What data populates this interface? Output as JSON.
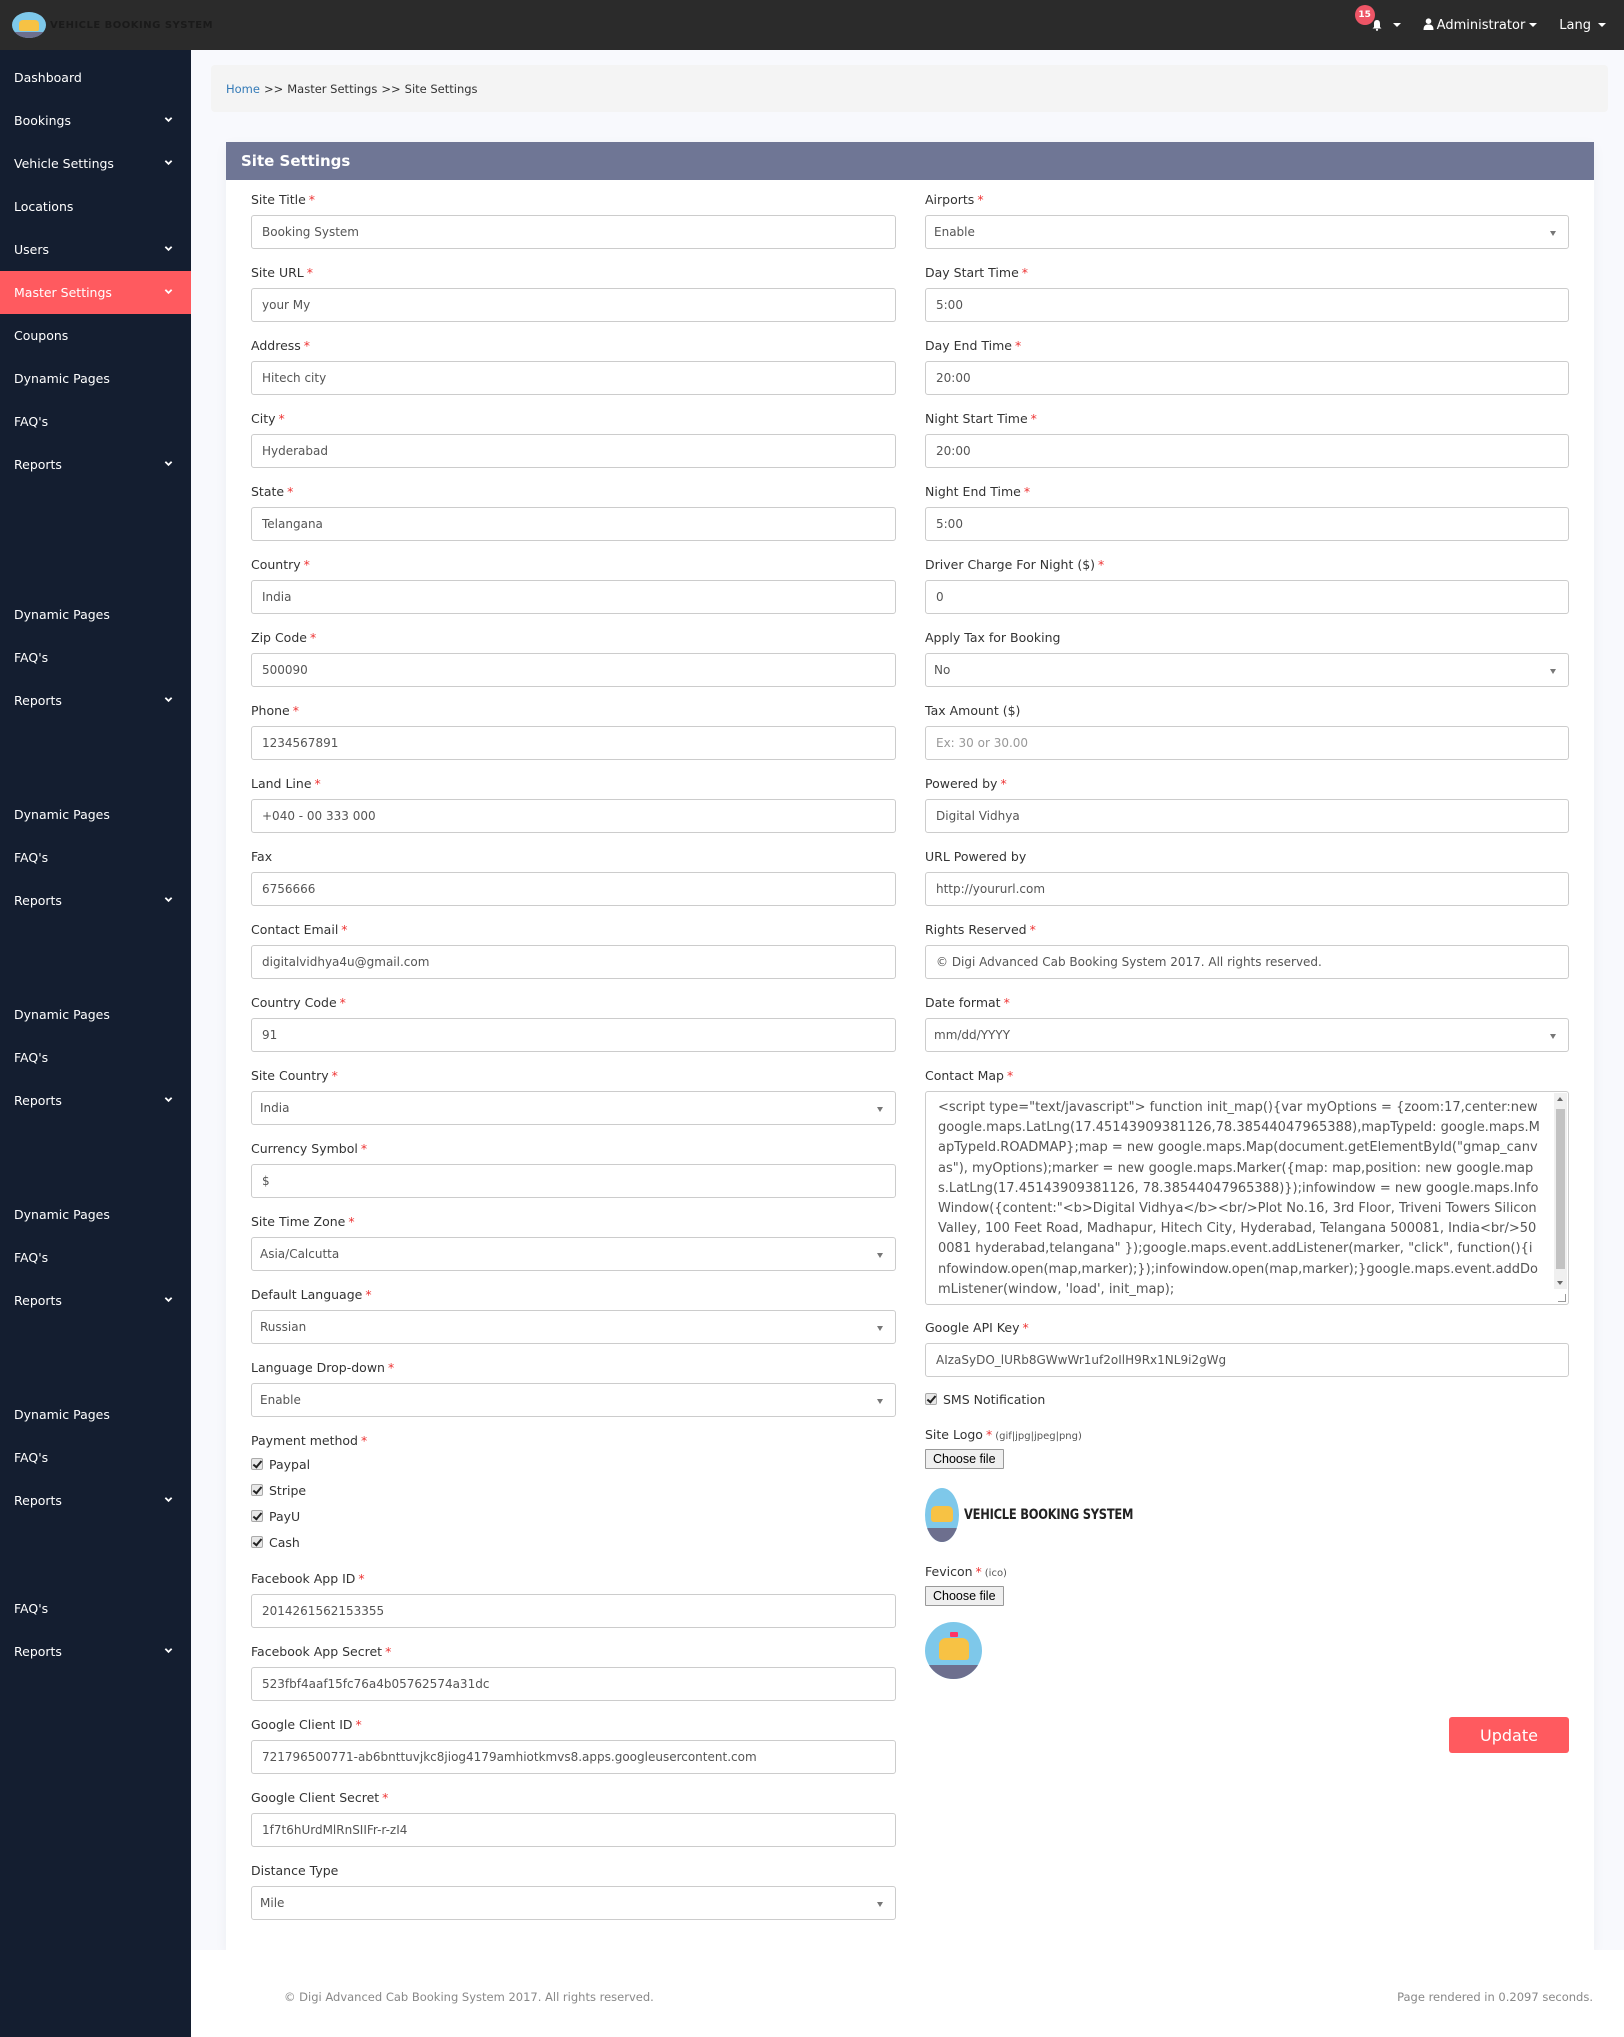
{
  "header": {
    "logo_text": "VEHICLE BOOKING SYSTEM",
    "notification_count": "15",
    "user_label": "Administrator",
    "lang_label": "Lang"
  },
  "sidebar": {
    "items": [
      {
        "label": "Dashboard",
        "has_chevron": false,
        "active": false
      },
      {
        "label": "Bookings",
        "has_chevron": true,
        "active": false
      },
      {
        "label": "Vehicle Settings",
        "has_chevron": true,
        "active": false
      },
      {
        "label": "Locations",
        "has_chevron": false,
        "active": false
      },
      {
        "label": "Users",
        "has_chevron": true,
        "active": false
      },
      {
        "label": "Master Settings",
        "has_chevron": true,
        "active": true
      },
      {
        "label": "Coupons",
        "has_chevron": false,
        "active": false
      },
      {
        "label": "Dynamic Pages",
        "has_chevron": false,
        "active": false
      },
      {
        "label": "FAQ's",
        "has_chevron": false,
        "active": false
      },
      {
        "label": "Reports",
        "has_chevron": true,
        "active": false
      },
      {
        "label": "Dynamic Pages",
        "has_chevron": false,
        "active": false
      },
      {
        "label": "FAQ's",
        "has_chevron": false,
        "active": false
      },
      {
        "label": "Reports",
        "has_chevron": true,
        "active": false
      },
      {
        "label": "Dynamic Pages",
        "has_chevron": false,
        "active": false
      },
      {
        "label": "FAQ's",
        "has_chevron": false,
        "active": false
      },
      {
        "label": "Reports",
        "has_chevron": true,
        "active": false
      },
      {
        "label": "Dynamic Pages",
        "has_chevron": false,
        "active": false
      },
      {
        "label": "FAQ's",
        "has_chevron": false,
        "active": false
      },
      {
        "label": "Reports",
        "has_chevron": true,
        "active": false
      },
      {
        "label": "Dynamic Pages",
        "has_chevron": false,
        "active": false
      },
      {
        "label": "FAQ's",
        "has_chevron": false,
        "active": false
      },
      {
        "label": "Reports",
        "has_chevron": true,
        "active": false
      },
      {
        "label": "Dynamic Pages",
        "has_chevron": false,
        "active": false
      },
      {
        "label": "FAQ's",
        "has_chevron": false,
        "active": false
      },
      {
        "label": "Reports",
        "has_chevron": true,
        "active": false
      },
      {
        "label": "FAQ's",
        "has_chevron": false,
        "active": false
      },
      {
        "label": "Reports",
        "has_chevron": true,
        "active": false
      }
    ]
  },
  "breadcrumb": {
    "home": "Home",
    "separator": ">>",
    "section": "Master Settings",
    "current": "Site Settings"
  },
  "panel": {
    "title": "Site Settings",
    "left": {
      "site_title": {
        "label": "Site Title",
        "value": "Booking System"
      },
      "site_url": {
        "label": "Site URL",
        "value": "your My"
      },
      "address": {
        "label": "Address",
        "value": "Hitech city"
      },
      "city": {
        "label": "City",
        "value": "Hyderabad"
      },
      "state": {
        "label": "State",
        "value": "Telangana"
      },
      "country": {
        "label": "Country",
        "value": "India"
      },
      "zip": {
        "label": "Zip Code",
        "value": "500090"
      },
      "phone": {
        "label": "Phone",
        "value": "1234567891"
      },
      "landline": {
        "label": "Land Line",
        "value": "+040 - 00 333 000"
      },
      "fax": {
        "label": "Fax",
        "value": "6756666"
      },
      "contact_email": {
        "label": "Contact Email",
        "value": "digitalvidhya4u@gmail.com"
      },
      "country_code": {
        "label": "Country Code",
        "value": "91"
      },
      "site_country": {
        "label": "Site Country",
        "value": "India"
      },
      "currency_symbol": {
        "label": "Currency Symbol",
        "value": "$"
      },
      "time_zone": {
        "label": "Site Time Zone",
        "value": "Asia/Calcutta"
      },
      "default_language": {
        "label": "Default Language",
        "value": "Russian"
      },
      "language_dropdown": {
        "label": "Language Drop-down",
        "value": "Enable"
      },
      "payment_method": {
        "label": "Payment method",
        "options": [
          {
            "label": "Paypal",
            "checked": true
          },
          {
            "label": "Stripe",
            "checked": true
          },
          {
            "label": "PayU",
            "checked": true
          },
          {
            "label": "Cash",
            "checked": true
          }
        ]
      },
      "fb_app_id": {
        "label": "Facebook App ID",
        "value": "2014261562153355"
      },
      "fb_app_secret": {
        "label": "Facebook App Secret",
        "value": "523fbf4aaf15fc76a4b05762574a31dc"
      },
      "google_client_id": {
        "label": "Google Client ID",
        "value": "721796500771-ab6bnttuvjkc8jiog4179amhiotkmvs8.apps.googleusercontent.com"
      },
      "google_client_secret": {
        "label": "Google Client Secret",
        "value": "1f7t6hUrdMlRnSIIFr-r-zI4"
      },
      "distance_type": {
        "label": "Distance Type",
        "value": "Mile"
      }
    },
    "right": {
      "airports": {
        "label": "Airports",
        "value": "Enable"
      },
      "day_start": {
        "label": "Day Start Time",
        "value": "5:00"
      },
      "day_end": {
        "label": "Day End Time",
        "value": "20:00"
      },
      "night_start": {
        "label": "Night Start Time",
        "value": "20:00"
      },
      "night_end": {
        "label": "Night End Time",
        "value": "5:00"
      },
      "driver_charge": {
        "label": "Driver Charge For Night ($)",
        "value": "0"
      },
      "apply_tax": {
        "label": "Apply Tax for Booking",
        "value": "No"
      },
      "tax_amount": {
        "label": "Tax Amount ($)",
        "placeholder": "Ex: 30 or 30.00"
      },
      "powered_by": {
        "label": "Powered by",
        "value": "Digital Vidhya"
      },
      "url_powered_by": {
        "label": "URL Powered by",
        "value": "http://yoururl.com"
      },
      "rights_reserved": {
        "label": "Rights Reserved",
        "value": "© Digi Advanced Cab Booking System 2017. All rights reserved."
      },
      "date_format": {
        "label": "Date format",
        "value": "mm/dd/YYYY"
      },
      "contact_map": {
        "label": "Contact Map",
        "value": "<script type=\"text/javascript\"> function init_map(){var myOptions = {zoom:17,center:new google.maps.LatLng(17.45143909381126,78.38544047965388),mapTypeId: google.maps.MapTypeId.ROADMAP};map = new google.maps.Map(document.getElementById(\"gmap_canvas\"), myOptions);marker = new google.maps.Marker({map: map,position: new google.maps.LatLng(17.45143909381126, 78.38544047965388)});infowindow = new google.maps.InfoWindow({content:\"<b>Digital Vidhya</b><br/>Plot No.16, 3rd Floor, Triveni Towers Silicon Valley, 100 Feet Road, Madhapur, Hitech City, Hyderabad, Telangana 500081, India<br/>500081 hyderabad,telangana\" });google.maps.event.addListener(marker, \"click\", function(){infowindow.open(map,marker);});infowindow.open(map,marker);}google.maps.event.addDomListener(window, 'load', init_map);"
      },
      "google_api_key": {
        "label": "Google API Key",
        "value": "AIzaSyDO_lURb8GWwWr1uf2oIlH9Rx1NL9i2gWg"
      },
      "sms_notification": {
        "label": "SMS Notification",
        "checked": true
      },
      "site_logo": {
        "label": "Site Logo",
        "hint": "(gif|jpg|jpeg|png)",
        "button": "Choose file",
        "preview_text": "VEHICLE BOOKING SYSTEM"
      },
      "favicon": {
        "label": "Fevicon",
        "hint": "(ico)",
        "button": "Choose file"
      }
    },
    "update_label": "Update"
  },
  "footer": {
    "copyright": "© Digi Advanced Cab Booking System 2017. All rights reserved.",
    "render_time": "Page rendered in 0.2097 seconds."
  },
  "colors": {
    "accent": "#ff5a5f",
    "sidebar_bg": "#141e30",
    "topbar_bg": "#2b2b2b",
    "panel_header": "#6f7695",
    "link": "#337ab7",
    "required": "#ee3333"
  }
}
